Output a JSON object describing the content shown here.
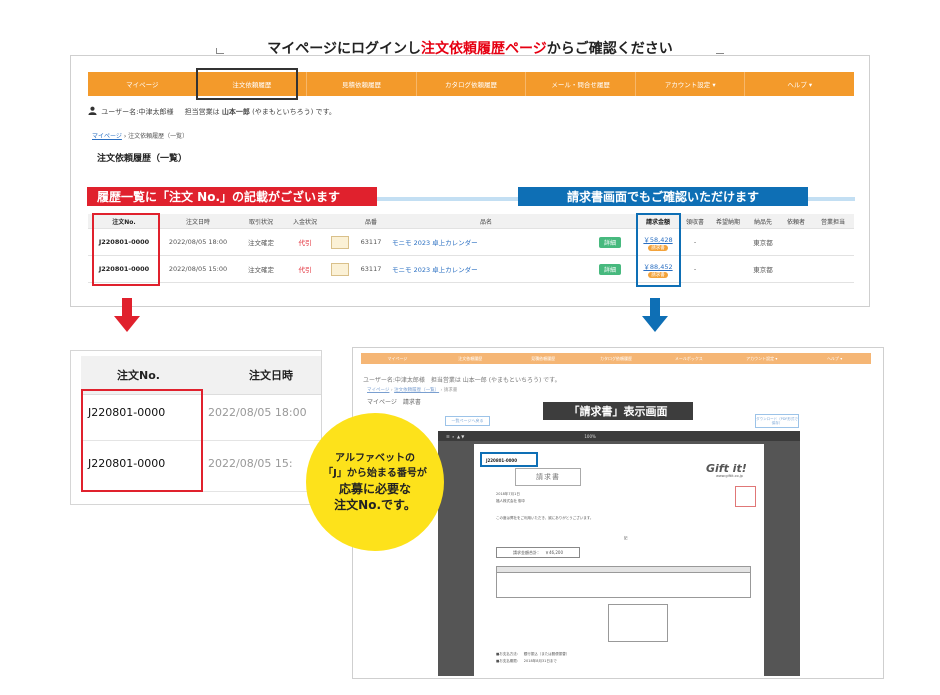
{
  "heading": {
    "before": "マイページにログインし",
    "highlight": "注文依頼履歴ページ",
    "after": "からご確認ください"
  },
  "nav": {
    "items": [
      "マイページ",
      "注文依頼履歴",
      "見積依頼履歴",
      "カタログ依頼履歴",
      "メール・問合せ履歴",
      "アカウント設定 ▾",
      "ヘルプ ▾"
    ]
  },
  "user": {
    "name_text": "ユーザー名:中津太郎様",
    "rep_prefix": "担当営業は",
    "rep_name": "山本一郎",
    "rep_suffix": "(やまもといちろう) です。"
  },
  "breadcrumb": {
    "link": "マイページ",
    "sep": "›",
    "current": "注文依頼履歴（一覧）"
  },
  "page_title": "注文依頼履歴（一覧）",
  "labels": {
    "red": "履歴一覧に「注文 No.」の記載がございます",
    "blue": "請求書画面でもご確認いただけます"
  },
  "table": {
    "headers": [
      "注文No.",
      "注文日時",
      "取引状況",
      "入金状況",
      "",
      "品番",
      "品名",
      "",
      "請求金額",
      "領収書",
      "希望納期",
      "納品先",
      "依頼者",
      "営業担当"
    ],
    "rows": [
      {
        "order_no": "J220801-0000",
        "date": "2022/08/05 18:00",
        "status": "注文確定",
        "payment": "代引",
        "code": "63117",
        "name": "モニモ 2023 卓上カレンダー",
        "detail": "詳細",
        "amount": "￥58,428",
        "badge": "請求書",
        "deadline": "-",
        "dest": "東京都"
      },
      {
        "order_no": "J220801-0000",
        "date": "2022/08/05 15:00",
        "status": "注文確定",
        "payment": "代引",
        "code": "63117",
        "name": "モニモ 2023 卓上カレンダー",
        "detail": "詳細",
        "amount": "￥88,452",
        "badge": "請求書",
        "deadline": "-",
        "dest": "東京都"
      }
    ]
  },
  "zoom": {
    "header_no": "注文No.",
    "header_date": "注文日時",
    "rows": [
      {
        "no": "J220801-0000",
        "date": "2022/08/05 18:00"
      },
      {
        "no": "J220801-0000",
        "date": "2022/08/05 15:"
      }
    ]
  },
  "bubble": {
    "lines": [
      "アルファベットの",
      "「J」から始まる番号が",
      "応募に必要な",
      "注文No.です。"
    ]
  },
  "invoice_window": {
    "nav": [
      "マイページ",
      "注文依頼履歴",
      "見積依頼履歴",
      "カタログ依頼履歴",
      "メールボックス",
      "アカウント設定 ▾",
      "ヘルプ ▾"
    ],
    "user_text": "ユーザー名:中津太郎様　担当営業は 山本一郎 (やまもといちろう) です。",
    "crumb_link1": "マイページ",
    "crumb_link2": "注文依頼履歴（一覧）",
    "crumb_current": "請求書",
    "title": "マイページ　請求書",
    "label": "「請求書」表示画面",
    "back_button": "一覧ページへ戻る",
    "download_button": "ダウンロード（PDF形式で保存）",
    "viewer_zoom": "100%",
    "doc": {
      "order_no": "J220801-0000",
      "title": "請求書",
      "date": "2018年7月1日",
      "company": "福人株式会社 御中",
      "logo": "Gift it!",
      "url": "www.giftit.co.jp",
      "greeting": "この度は弊社をご利用いただき、誠にありがとうございます。",
      "note": "記",
      "amount_label": "請求金額合計：　￥46,200",
      "footer1": "■お支払方法：　銀行振込（または郵便振替）",
      "footer2": "■お支払期限：　2018年8月31日まで"
    }
  },
  "colors": {
    "nav_orange": "#f39a2b",
    "red": "#e0212d",
    "blue": "#0e6fb5",
    "yellow": "#fde21b"
  }
}
